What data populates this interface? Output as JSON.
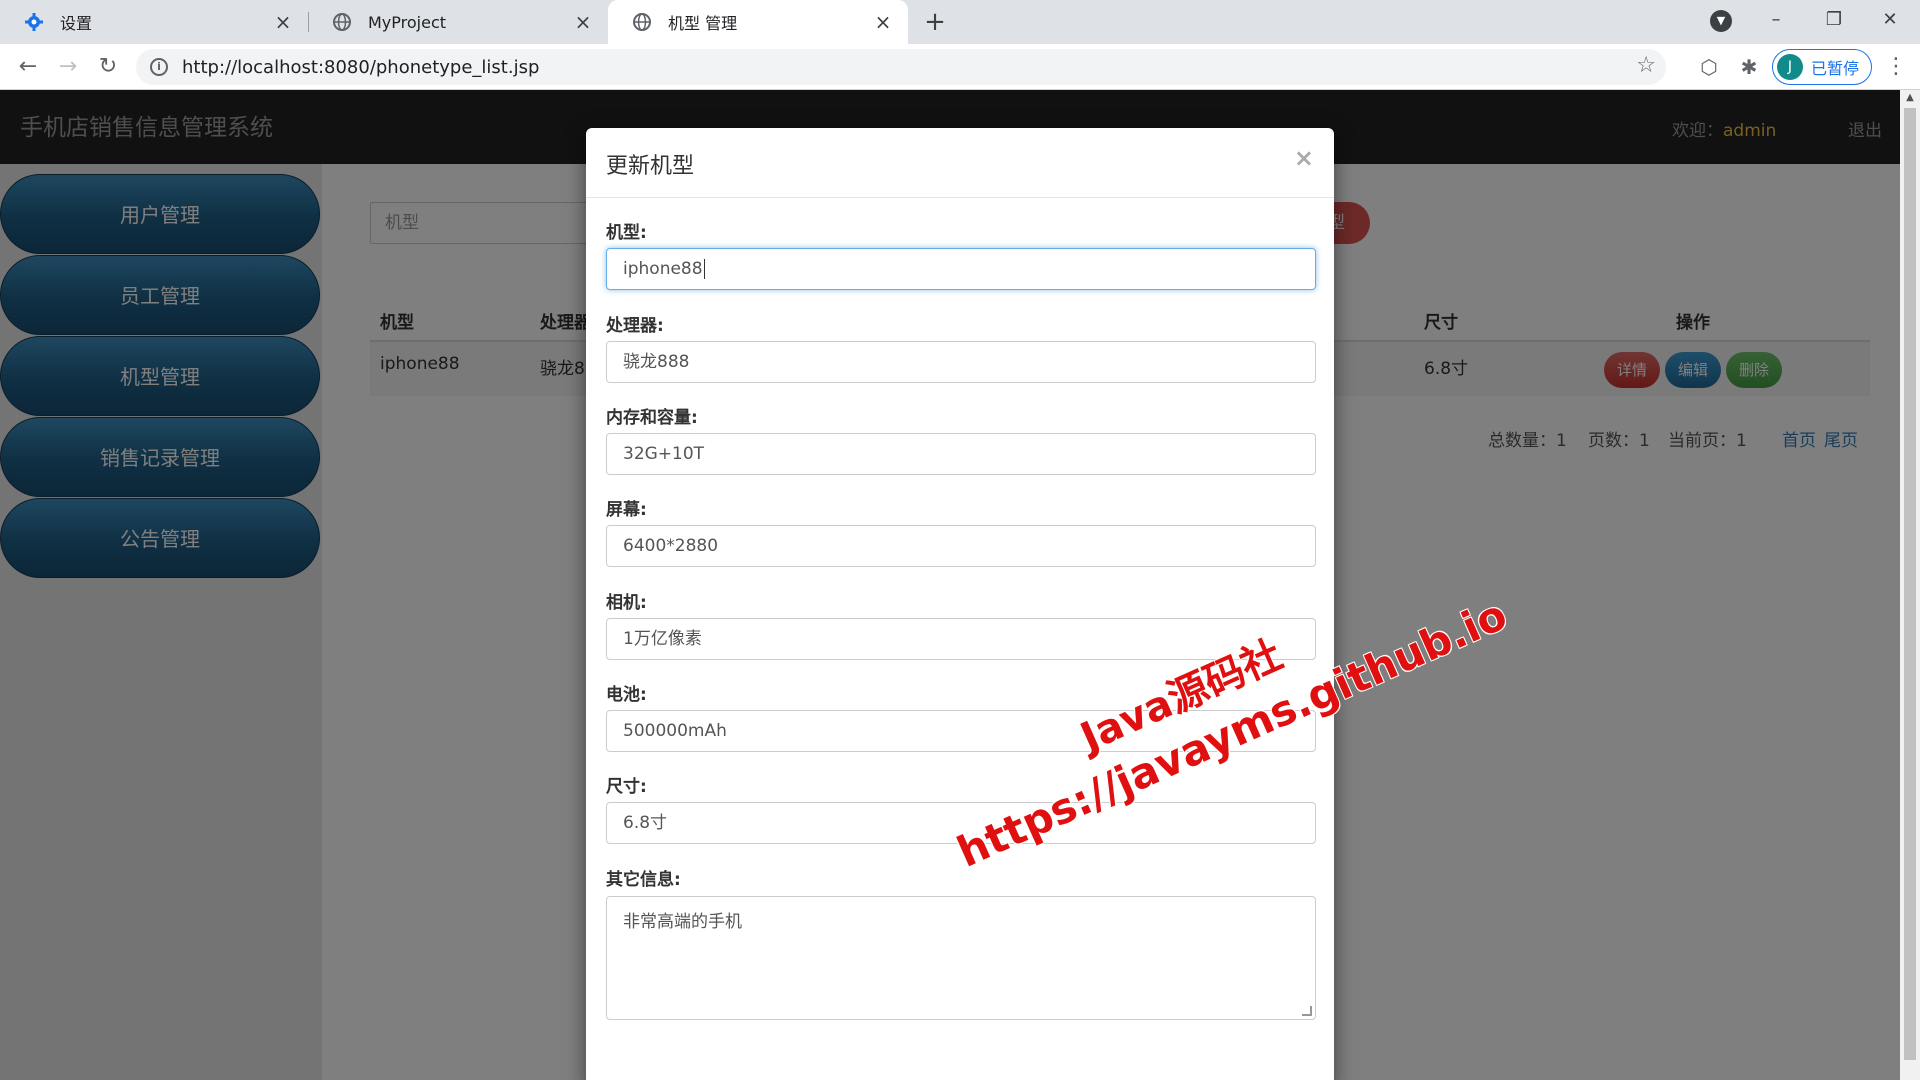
{
  "browser": {
    "tabs": [
      {
        "title": "设置",
        "icon": "gear-icon"
      },
      {
        "title": "MyProject",
        "icon": "globe-icon"
      },
      {
        "title": "机型 管理",
        "icon": "globe-icon"
      }
    ],
    "url": "http://localhost:8080/phonetype_list.jsp",
    "profile_avatar": "J",
    "profile_status": "已暂停"
  },
  "app": {
    "title": "手机店销售信息管理系统",
    "welcome_label": "欢迎：",
    "username": "admin",
    "logout": "退出"
  },
  "sidebar": {
    "items": [
      {
        "label": "用户管理"
      },
      {
        "label": "员工管理"
      },
      {
        "label": "机型管理"
      },
      {
        "label": "销售记录管理"
      },
      {
        "label": "公告管理"
      }
    ]
  },
  "list": {
    "search_placeholder": "机型",
    "add_button_partial": "型",
    "headers": {
      "model": "机型",
      "cpu": "处理器",
      "size": "尺寸",
      "actions": "操作"
    },
    "row": {
      "model": "iphone88",
      "cpu_partial": "骁龙8",
      "size": "6.8寸"
    },
    "actions": {
      "detail": "详情",
      "edit": "编辑",
      "delete": "删除"
    },
    "pager": {
      "total": "总数量：1",
      "pages": "页数：1",
      "current": "当前页：1",
      "first": "首页",
      "last": "尾页"
    }
  },
  "modal": {
    "title": "更新机型",
    "close": "×",
    "fields": {
      "model": {
        "label": "机型:",
        "value": "iphone88"
      },
      "cpu": {
        "label": "处理器:",
        "value": "骁龙888"
      },
      "memory": {
        "label": "内存和容量:",
        "value": "32G+10T"
      },
      "screen": {
        "label": "屏幕:",
        "value": "6400*2880"
      },
      "camera": {
        "label": "相机:",
        "value": "1万亿像素"
      },
      "battery": {
        "label": "电池:",
        "value": "500000mAh"
      },
      "size": {
        "label": "尺寸:",
        "value": "6.8寸"
      },
      "other": {
        "label": "其它信息:",
        "value": "非常高端的手机"
      }
    }
  },
  "watermark": {
    "line1": "Java源码社",
    "line2": "https://javayms.github.io"
  },
  "colors": {
    "header_bg": "#222222",
    "sidebar_button": "#1f5f87",
    "danger": "#d9534f",
    "primary": "#1f6a9a",
    "success": "#449d44",
    "watermark": "#e01010"
  }
}
